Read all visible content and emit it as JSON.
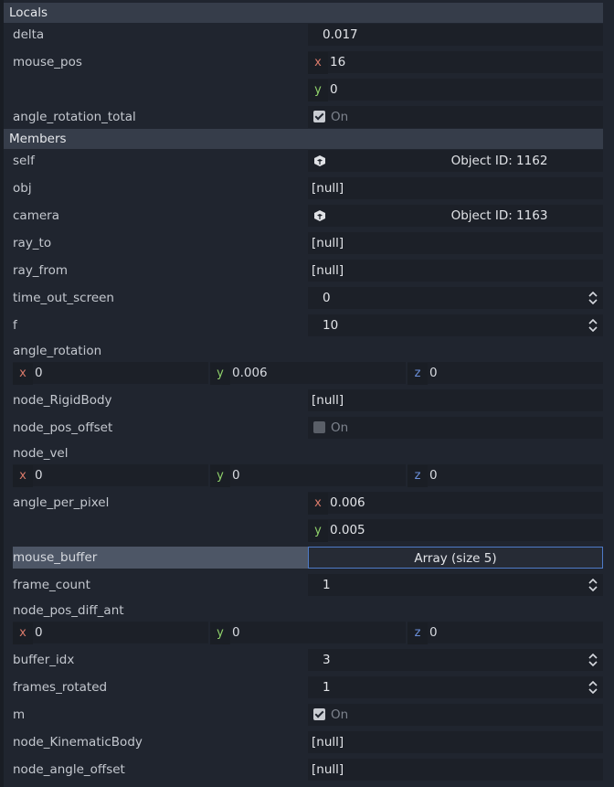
{
  "locals_header": "Locals",
  "members_header": "Members",
  "rows": {
    "delta": {
      "label": "delta",
      "value": "0.017"
    },
    "mouse_pos": {
      "label": "mouse_pos",
      "x": "16",
      "y": "0"
    },
    "angle_rotation_total": {
      "label": "angle_rotation_total",
      "value": "On",
      "checked": true
    },
    "self": {
      "label": "self",
      "value": "Object ID: 1162"
    },
    "obj": {
      "label": "obj",
      "value": "[null]"
    },
    "camera": {
      "label": "camera",
      "value": "Object ID: 1163"
    },
    "ray_to": {
      "label": "ray_to",
      "value": "[null]"
    },
    "ray_from": {
      "label": "ray_from",
      "value": "[null]"
    },
    "time_out_screen": {
      "label": "time_out_screen",
      "value": "0"
    },
    "f": {
      "label": "f",
      "value": "10"
    },
    "angle_rotation": {
      "label": "angle_rotation",
      "x": "0",
      "y": "0.006",
      "z": "0"
    },
    "node_RigidBody": {
      "label": "node_RigidBody",
      "value": "[null]"
    },
    "node_pos_offset": {
      "label": "node_pos_offset",
      "value": "On",
      "checked": false
    },
    "node_vel": {
      "label": "node_vel",
      "x": "0",
      "y": "0",
      "z": "0"
    },
    "angle_per_pixel": {
      "label": "angle_per_pixel",
      "x": "0.006",
      "y": "0.005"
    },
    "mouse_buffer": {
      "label": "mouse_buffer",
      "value": "Array (size 5)"
    },
    "frame_count": {
      "label": "frame_count",
      "value": "1"
    },
    "node_pos_diff_ant": {
      "label": "node_pos_diff_ant",
      "x": "0",
      "y": "0",
      "z": "0"
    },
    "buffer_idx": {
      "label": "buffer_idx",
      "value": "3"
    },
    "frames_rotated": {
      "label": "frames_rotated",
      "value": "1"
    },
    "m": {
      "label": "m",
      "value": "On",
      "checked": true
    },
    "node_KinematicBody": {
      "label": "node_KinematicBody",
      "value": "[null]"
    },
    "node_angle_offset": {
      "label": "node_angle_offset",
      "value": "[null]"
    }
  },
  "axis": {
    "x": "x",
    "y": "y",
    "z": "z"
  }
}
